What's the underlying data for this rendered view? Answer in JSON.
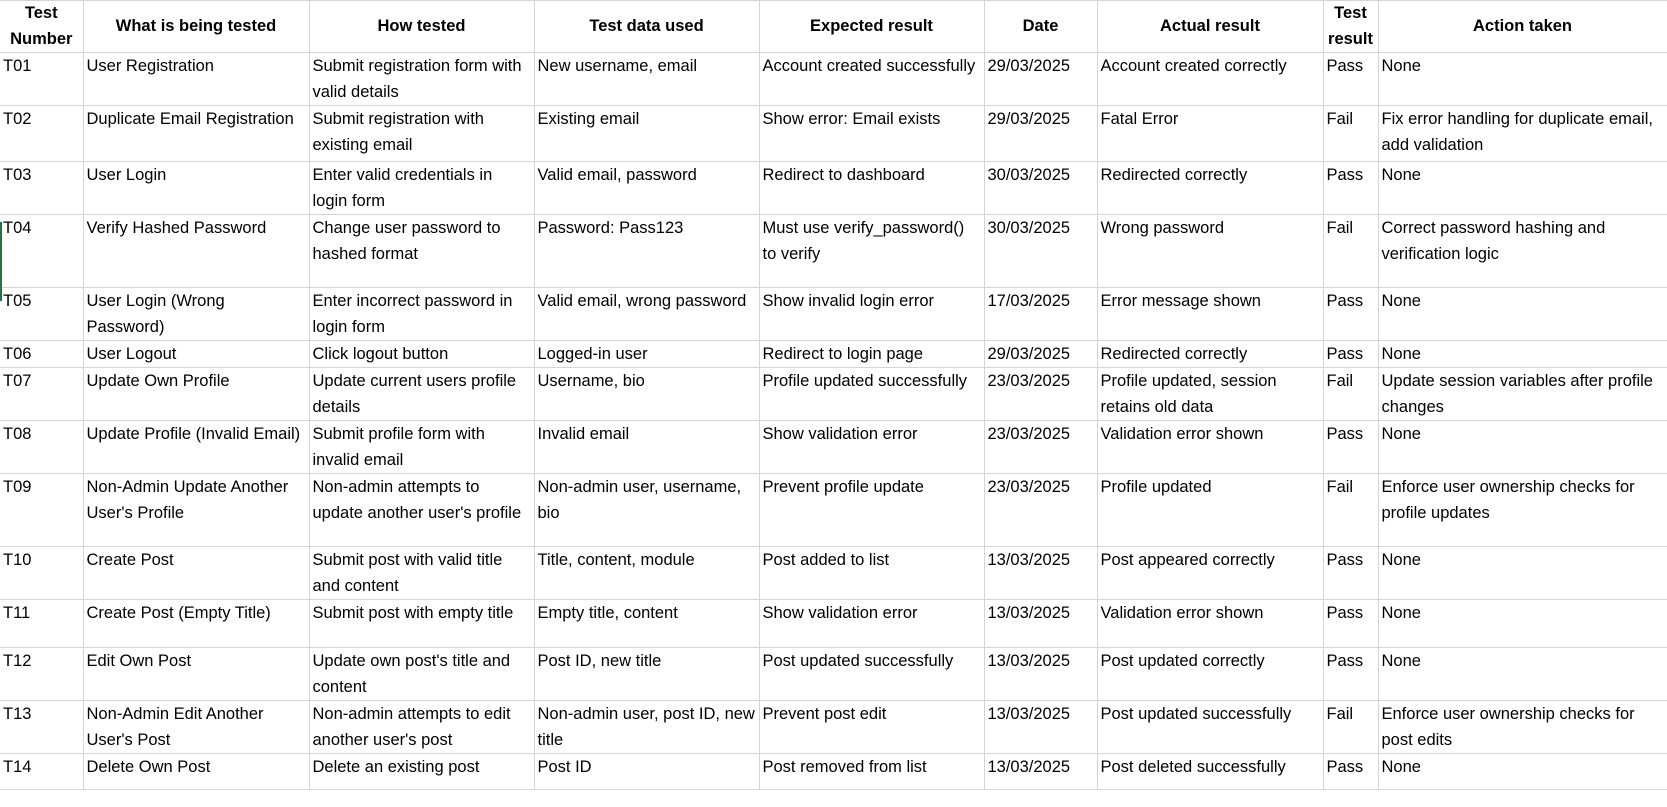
{
  "columns": [
    "Test Number",
    "What is being tested",
    "How tested",
    "Test data used",
    "Expected result",
    "Date",
    "Actual result",
    "Test result",
    "Action taken"
  ],
  "rows": [
    [
      "T01",
      "User Registration",
      "Submit registration form with valid details",
      "New username, email",
      "Account created successfully",
      "29/03/2025",
      "Account created correctly",
      "Pass",
      "None"
    ],
    [
      "T02",
      "Duplicate Email Registration",
      "Submit registration with existing email",
      "Existing email",
      "Show error: Email exists",
      "29/03/2025",
      "Fatal Error",
      "Fail",
      "Fix error handling for duplicate email, add validation"
    ],
    [
      "T03",
      "User Login",
      "Enter valid credentials in login form",
      "Valid email, password",
      "Redirect to dashboard",
      "30/03/2025",
      "Redirected correctly",
      "Pass",
      "None"
    ],
    [
      "T04",
      "Verify Hashed Password",
      "Change user password to hashed format",
      "Password: Pass123",
      "Must use verify_password() to verify",
      "30/03/2025",
      "Wrong password",
      "Fail",
      "Correct password hashing and verification logic"
    ],
    [
      "T05",
      "User Login (Wrong Password)",
      "Enter incorrect password in login form",
      "Valid email, wrong password",
      "Show invalid login error",
      "17/03/2025",
      "Error message shown",
      "Pass",
      "None"
    ],
    [
      "T06",
      "User Logout",
      "Click logout button",
      "Logged-in user",
      "Redirect to login page",
      "29/03/2025",
      "Redirected correctly",
      "Pass",
      "None"
    ],
    [
      "T07",
      "Update Own Profile",
      "Update current users profile details",
      "Username, bio",
      "Profile updated successfully",
      "23/03/2025",
      "Profile updated, session retains old data",
      "Fail",
      "Update session variables after profile changes"
    ],
    [
      "T08",
      "Update Profile (Invalid Email)",
      "Submit profile form with invalid email",
      "Invalid email",
      "Show validation error",
      "23/03/2025",
      "Validation error shown",
      "Pass",
      "None"
    ],
    [
      "T09",
      "Non-Admin Update Another User's Profile",
      "Non-admin attempts to update another user's profile",
      "Non-admin user, username, bio",
      "Prevent profile update",
      "23/03/2025",
      "Profile updated",
      "Fail",
      "Enforce user ownership checks for profile updates"
    ],
    [
      "T10",
      "Create Post",
      "Submit post with valid title and content",
      "Title, content, module",
      "Post added to list",
      "13/03/2025",
      "Post appeared correctly",
      "Pass",
      "None"
    ],
    [
      "T11",
      "Create Post (Empty Title)",
      "Submit post with empty title",
      "Empty title, content",
      "Show validation error",
      "13/03/2025",
      "Validation error shown",
      "Pass",
      "None"
    ],
    [
      "T12",
      "Edit Own Post",
      "Update own post's title and content",
      "Post ID, new title",
      "Post updated successfully",
      "13/03/2025",
      "Post updated correctly",
      "Pass",
      "None"
    ],
    [
      "T13",
      "Non-Admin Edit Another User's Post",
      "Non-admin attempts to edit another user's post",
      "Non-admin user, post ID, new title",
      "Prevent post edit",
      "13/03/2025",
      "Post updated successfully",
      "Fail",
      "Enforce user ownership checks for post edits"
    ],
    [
      "T14",
      "Delete Own Post",
      "Delete an existing post",
      "Post ID",
      "Post removed from list",
      "13/03/2025",
      "Post deleted successfully",
      "Pass",
      "None"
    ]
  ],
  "colors": {
    "gridline": "#d4d4d4",
    "selection_edge": "#217346"
  }
}
